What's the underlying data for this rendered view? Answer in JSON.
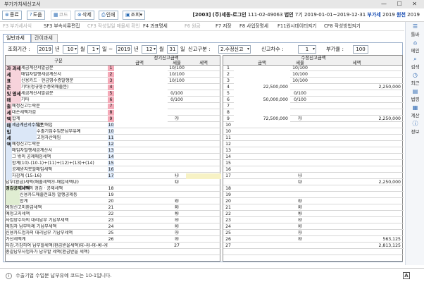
{
  "window": {
    "title": "부가가치세신고서",
    "controls": "— ☐ ✕"
  },
  "toolbar": {
    "buttons": [
      {
        "icon": "close-icon",
        "label": "종료",
        "disabled": false
      },
      {
        "icon": "help-icon",
        "label": "도움",
        "disabled": false
      },
      {
        "icon": "code-icon",
        "label": "코드",
        "disabled": true
      },
      {
        "icon": "delete-icon",
        "label": "삭제",
        "disabled": false
      },
      {
        "icon": "print-icon",
        "label": "인쇄",
        "disabled": false
      },
      {
        "icon": "search-icon",
        "label": "조회",
        "disabled": false
      }
    ],
    "company_code": "[2003]",
    "company_name": "(주)세동-로그인",
    "company_id": "111-02-49063",
    "company_type": "법인",
    "company_no": "7기",
    "period": "2019-01-01~2019-12-31",
    "dept": "부가세",
    "year": "2019",
    "mode": "원천",
    "mode_year": "2019"
  },
  "fkeys": [
    {
      "label": "F3 부가세서식",
      "disabled": true
    },
    {
      "label": "SF3 부속서류편집",
      "disabled": false
    },
    {
      "label": "CF3 작성일일 매물세 확인",
      "disabled": true
    },
    {
      "label": "F4 과표명세",
      "disabled": false
    },
    {
      "label": "F6 원금",
      "disabled": true
    },
    {
      "label": "F7 저장",
      "disabled": false
    },
    {
      "label": "F8 사업장명세",
      "disabled": false
    },
    {
      "label": "F11원시데이터켜기",
      "disabled": false
    },
    {
      "label": "CF8 작성방법켜기",
      "disabled": false
    }
  ],
  "tabs": [
    "일반과세",
    "간이과세"
  ],
  "filter": {
    "period_label": "조회기간 :",
    "year_from": "2019",
    "year_sfx": "년",
    "month_from": "10",
    "month_sfx": "월",
    "day_from": "1",
    "day_sfx": "일 ~",
    "year_to": "2019",
    "month_to": "12",
    "day_to": "31",
    "report_type_label": "신고구분 :",
    "report_type": "2.수정신고",
    "report_seq_label": "신고차수 :",
    "report_seq": "1",
    "rate_label": "부가율 :",
    "rate": "100"
  },
  "left_table": {
    "title": "정기신고금액",
    "headers": {
      "item": "구분",
      "amount": "금액",
      "rate": "세율",
      "tax": "세액"
    },
    "rows": [
      {
        "name": "세금계산서발급분",
        "no": "1",
        "amount": "",
        "rate": "10/100",
        "tax": ""
      },
      {
        "name": "매입자발행세금계산서",
        "no": "2",
        "amount": "",
        "rate": "10/100",
        "tax": ""
      },
      {
        "name": "신용카드 · 현금영수증발행분",
        "no": "3",
        "amount": "",
        "rate": "10/100",
        "tax": ""
      },
      {
        "name": "기타(정규영수증외매출분)",
        "no": "4",
        "amount": "",
        "rate": "",
        "tax": ""
      },
      {
        "name": "세금계산서발급분",
        "no": "5",
        "amount": "",
        "rate": "0/100",
        "tax": ""
      },
      {
        "name": "기타",
        "no": "6",
        "amount": "",
        "rate": "0/100",
        "tax": ""
      },
      {
        "name": "예정신고누락분",
        "no": "7",
        "amount": "",
        "rate": "",
        "tax": ""
      },
      {
        "name": "대손세액가감",
        "no": "8",
        "amount": "",
        "rate": "",
        "tax": ""
      },
      {
        "name": "합계",
        "no": "9",
        "amount": "",
        "rate": "㉮",
        "tax": ""
      },
      {
        "name": "일반매입",
        "no": "10",
        "amount": "",
        "rate": "",
        "tax": ""
      },
      {
        "name": "수출기업수입분납부유예",
        "no": "10",
        "amount": "",
        "rate": "",
        "tax": ""
      },
      {
        "name": "고정자산매입",
        "no": "11",
        "amount": "",
        "rate": "",
        "tax": ""
      },
      {
        "name": "예정신고누락분",
        "no": "12",
        "amount": "",
        "rate": "",
        "tax": ""
      },
      {
        "name": "매입자발행세금계산서",
        "no": "13",
        "amount": "",
        "rate": "",
        "tax": ""
      },
      {
        "name": "그 밖의 공제매입세액",
        "no": "14",
        "amount": "",
        "rate": "",
        "tax": ""
      },
      {
        "name": "합계(10)-(10-1)+(11)+(12)+(13)+(14)",
        "no": "15",
        "amount": "",
        "rate": "",
        "tax": ""
      },
      {
        "name": "공제받지못할매입세액",
        "no": "16",
        "amount": "",
        "rate": "",
        "tax": ""
      },
      {
        "name": "차감계 (15-16)",
        "no": "17",
        "amount": "",
        "rate": "㉯",
        "tax": ""
      },
      {
        "name": "납부(환급)세액(매출세액㉮-매입세액㉯)",
        "no": "",
        "amount": "",
        "rate": "㉰",
        "tax": ""
      },
      {
        "name": "그 밖의 경감 · 공제세액",
        "no": "18",
        "amount": "",
        "rate": "",
        "tax": ""
      },
      {
        "name": "신용카드매출전표등 발행공제등",
        "no": "19",
        "amount": "",
        "rate": "",
        "tax": ""
      },
      {
        "name": "합계",
        "no": "20",
        "amount": "",
        "rate": "㉱",
        "tax": ""
      },
      {
        "name": "예정신고미환급세액",
        "no": "21",
        "amount": "",
        "rate": "㉲",
        "tax": ""
      },
      {
        "name": "예정고지세액",
        "no": "22",
        "amount": "",
        "rate": "㉳",
        "tax": ""
      },
      {
        "name": "사업양수자의 대리납부 기납부세액",
        "no": "23",
        "amount": "",
        "rate": "㉴",
        "tax": ""
      },
      {
        "name": "매입자 납부특례 기납부세액",
        "no": "24",
        "amount": "",
        "rate": "㉵",
        "tax": ""
      },
      {
        "name": "신용카드업자의 대리납부 기납부세액",
        "no": "25",
        "amount": "",
        "rate": "㉶",
        "tax": ""
      },
      {
        "name": "가산세액계",
        "no": "26",
        "amount": "",
        "rate": "㉷",
        "tax": ""
      },
      {
        "name": "차감.가감하여 납부할세액(환급받을세액)㉰-㉱-㉲-㉳-㉴-㉵-㉶+㉷",
        "no": "",
        "amount": "",
        "rate": "27",
        "tax": ""
      },
      {
        "name": "총괄납부사업자가 납부할 세액(환급받을 세액)",
        "no": "",
        "amount": "",
        "rate": "",
        "tax": ""
      }
    ]
  },
  "categories": {
    "sales": "과세표준및매출세액",
    "purchase": "매입세액",
    "deduct": "경감공제세액",
    "taxable": "과세",
    "zero": "영세",
    "invoice": "세금계산서수취분"
  },
  "right_table": {
    "title": "수정신고금액",
    "headers": {
      "amount": "금액",
      "rate": "세율",
      "tax": "세액"
    },
    "rows": [
      {
        "no": "1",
        "amount": "",
        "rate": "10/100",
        "tax": ""
      },
      {
        "no": "2",
        "amount": "",
        "rate": "10/100",
        "tax": ""
      },
      {
        "no": "3",
        "amount": "",
        "rate": "10/100",
        "tax": ""
      },
      {
        "no": "4",
        "amount": "22,500,000",
        "rate": "",
        "tax": "2,250,000"
      },
      {
        "no": "5",
        "amount": "",
        "rate": "0/100",
        "tax": ""
      },
      {
        "no": "6",
        "amount": "50,000,000",
        "rate": "0/100",
        "tax": ""
      },
      {
        "no": "7",
        "amount": "",
        "rate": "",
        "tax": ""
      },
      {
        "no": "8",
        "amount": "",
        "rate": "",
        "tax": ""
      },
      {
        "no": "9",
        "amount": "72,500,000",
        "rate": "㉮",
        "tax": "2,250,000"
      },
      {
        "no": "10",
        "amount": "",
        "rate": "",
        "tax": ""
      },
      {
        "no": "10",
        "amount": "",
        "rate": "",
        "tax": ""
      },
      {
        "no": "11",
        "amount": "",
        "rate": "",
        "tax": ""
      },
      {
        "no": "12",
        "amount": "",
        "rate": "",
        "tax": ""
      },
      {
        "no": "13",
        "amount": "",
        "rate": "",
        "tax": ""
      },
      {
        "no": "14",
        "amount": "",
        "rate": "",
        "tax": ""
      },
      {
        "no": "15",
        "amount": "",
        "rate": "",
        "tax": ""
      },
      {
        "no": "16",
        "amount": "",
        "rate": "",
        "tax": ""
      },
      {
        "no": "17",
        "amount": "",
        "rate": "㉯",
        "tax": ""
      },
      {
        "no": "",
        "amount": "",
        "rate": "㉰",
        "tax": "2,250,000"
      },
      {
        "no": "18",
        "amount": "",
        "rate": "",
        "tax": ""
      },
      {
        "no": "19",
        "amount": "",
        "rate": "",
        "tax": ""
      },
      {
        "no": "20",
        "amount": "",
        "rate": "㉱",
        "tax": ""
      },
      {
        "no": "21",
        "amount": "",
        "rate": "㉲",
        "tax": ""
      },
      {
        "no": "22",
        "amount": "",
        "rate": "㉳",
        "tax": ""
      },
      {
        "no": "23",
        "amount": "",
        "rate": "㉴",
        "tax": ""
      },
      {
        "no": "24",
        "amount": "",
        "rate": "㉵",
        "tax": ""
      },
      {
        "no": "25",
        "amount": "",
        "rate": "㉶",
        "tax": ""
      },
      {
        "no": "26",
        "amount": "",
        "rate": "㉷",
        "tax": "563,125"
      },
      {
        "no": "27",
        "amount": "",
        "rate": "",
        "tax": "2,813,125"
      },
      {
        "no": "",
        "amount": "",
        "rate": "",
        "tax": ""
      }
    ]
  },
  "sidebar": [
    {
      "icon": "menu-icon",
      "label": "툴바"
    },
    {
      "icon": "home-icon",
      "label": "메인"
    },
    {
      "icon": "search-icon",
      "label": "검색"
    },
    {
      "icon": "clock-icon",
      "label": "최근"
    },
    {
      "icon": "book-icon",
      "label": "법령"
    },
    {
      "icon": "calculator-icon",
      "label": "계산"
    },
    {
      "icon": "info-icon",
      "label": "정보"
    }
  ],
  "status": {
    "message": "수출기업 수입분 납부유예 코드는 10-1입니다.",
    "ime": "A"
  }
}
